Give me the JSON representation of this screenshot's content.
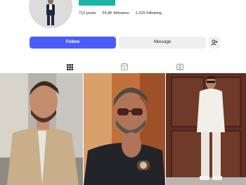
{
  "profile": {
    "posts": "712 posts",
    "followers": "24,9K followers",
    "following": "1.215 following"
  },
  "buttons": {
    "follow_label": "Follow",
    "message_label": "Message"
  },
  "tabs": [
    {
      "icon": "grid-icon",
      "active": true
    },
    {
      "icon": "reels-icon",
      "active": false
    },
    {
      "icon": "tagged-icon",
      "active": false
    }
  ],
  "posts": [
    {
      "description": "man in tan jacket outdoors"
    },
    {
      "description": "man in sunglasses with watch"
    },
    {
      "description": "man in white knit outfit by wooden door"
    }
  ],
  "colors": {
    "accent": "#4a5df9",
    "teal": "#1bb5a6"
  }
}
